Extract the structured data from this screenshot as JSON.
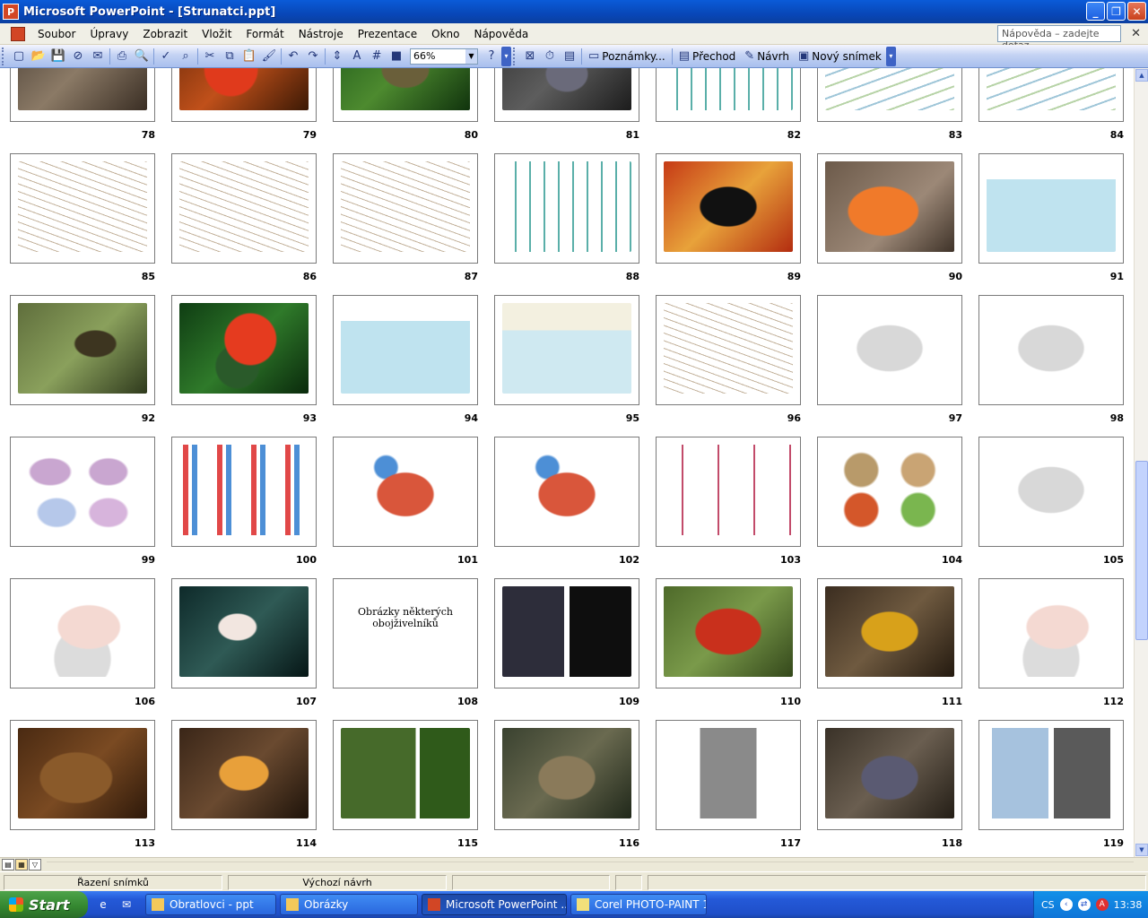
{
  "window": {
    "title": "Microsoft PowerPoint - [Strunatci.ppt]",
    "app_icon": "powerpoint-icon",
    "buttons": [
      "minimize-icon",
      "restore-icon",
      "close-icon"
    ]
  },
  "menu": {
    "items": [
      "Soubor",
      "Úpravy",
      "Zobrazit",
      "Vložit",
      "Formát",
      "Nástroje",
      "Prezentace",
      "Okno",
      "Nápověda"
    ],
    "help_placeholder": "Nápověda – zadejte dotaz"
  },
  "toolbar": {
    "zoom": "66%",
    "notes_label": "Poznámky...",
    "transition_label": "Přechod",
    "design_label": "Návrh",
    "new_slide_label": "Nový snímek"
  },
  "slides": [
    {
      "num": "78",
      "art": "a-photo-rock"
    },
    {
      "num": "79",
      "art": "a-photo-red"
    },
    {
      "num": "80",
      "art": "a-photo-green"
    },
    {
      "num": "81",
      "art": "a-photo-dark"
    },
    {
      "num": "82",
      "art": "a-tree"
    },
    {
      "num": "83",
      "art": "a-diagram"
    },
    {
      "num": "84",
      "art": "a-diagram"
    },
    {
      "num": "85",
      "art": "a-sketch"
    },
    {
      "num": "86",
      "art": "a-sketch"
    },
    {
      "num": "87",
      "art": "a-sketch"
    },
    {
      "num": "88",
      "art": "a-tree"
    },
    {
      "num": "89",
      "art": "a-salamander"
    },
    {
      "num": "90",
      "art": "a-newt"
    },
    {
      "num": "91",
      "art": "a-pond"
    },
    {
      "num": "92",
      "art": "a-tadpole"
    },
    {
      "num": "93",
      "art": "a-frogred"
    },
    {
      "num": "94",
      "art": "a-pond"
    },
    {
      "num": "95",
      "art": "a-pondlife"
    },
    {
      "num": "96",
      "art": "a-sketch"
    },
    {
      "num": "97",
      "art": "a-grey"
    },
    {
      "num": "98",
      "art": "a-grey"
    },
    {
      "num": "99",
      "art": "a-lungs"
    },
    {
      "num": "100",
      "art": "a-circ"
    },
    {
      "num": "101",
      "art": "a-heart"
    },
    {
      "num": "102",
      "art": "a-heart"
    },
    {
      "num": "103",
      "art": "a-veins"
    },
    {
      "num": "104",
      "art": "a-frogs4"
    },
    {
      "num": "105",
      "art": "a-grey"
    },
    {
      "num": "106",
      "art": "a-axolotl"
    },
    {
      "num": "107",
      "art": "a-cave"
    },
    {
      "num": "108",
      "art": "",
      "caption": "Obrázky některých obojživelníků"
    },
    {
      "num": "109",
      "art": "a-collage"
    },
    {
      "num": "110",
      "art": "a-redsal"
    },
    {
      "num": "111",
      "art": "a-tigersal"
    },
    {
      "num": "112",
      "art": "a-axolotl"
    },
    {
      "num": "113",
      "art": "a-toad"
    },
    {
      "num": "114",
      "art": "a-toad2"
    },
    {
      "num": "115",
      "art": "a-frogpair"
    },
    {
      "num": "116",
      "art": "a-toad3"
    },
    {
      "num": "117",
      "art": "a-bw"
    },
    {
      "num": "118",
      "art": "a-caecil"
    },
    {
      "num": "119",
      "art": "a-worms"
    }
  ],
  "status": {
    "view": "Řazení snímků",
    "design": "Výchozí návrh"
  },
  "taskbar": {
    "start": "Start",
    "tasks": [
      {
        "label": "Obratlovci - ppt",
        "icon": "folder-icon",
        "active": false
      },
      {
        "label": "Obrázky",
        "icon": "folder-icon",
        "active": false
      },
      {
        "label": "Microsoft PowerPoint ...",
        "icon": "powerpoint-icon",
        "active": true
      },
      {
        "label": "Corel PHOTO-PAINT 11",
        "icon": "corel-icon",
        "active": false
      }
    ],
    "language": "CS",
    "clock": "13:38"
  }
}
